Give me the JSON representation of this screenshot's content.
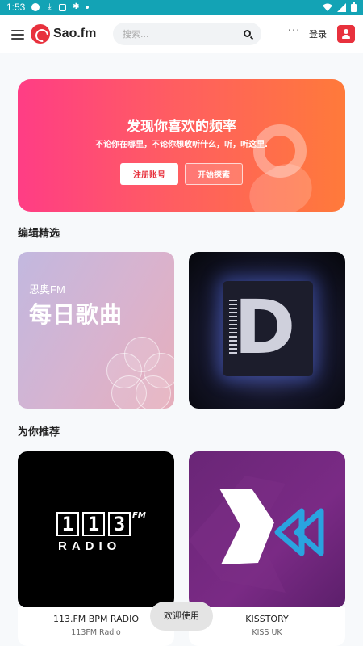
{
  "status_bar": {
    "time": "1:53",
    "icons_left": [
      "record-icon",
      "download-icon",
      "notification-icon",
      "bug-icon",
      "dot-icon"
    ],
    "icons_right": [
      "wifi-icon",
      "signal-icon",
      "battery-icon"
    ],
    "color": "#13a3b5"
  },
  "header": {
    "brand": "Sao.fm",
    "search_placeholder": "搜索...",
    "more_label": "···",
    "login_label": "登录",
    "accent": "#e8313d"
  },
  "banner": {
    "title": "发现你喜欢的频率",
    "subtitle": "不论你在哪里，不论你想收听什么，听，听这里.",
    "register_label": "注册账号",
    "explore_label": "开始探索"
  },
  "editors_picks": {
    "title": "编辑精选",
    "cards": [
      {
        "kicker": "思奥FM",
        "headline": "每日歌曲"
      },
      {
        "image": "dj-logo-artwork"
      }
    ]
  },
  "recommended": {
    "title": "为你推荐",
    "stations": [
      {
        "name": "113.FM BPM RADIO",
        "sub": "113FM Radio",
        "logo_digits": [
          "1",
          "1",
          "3"
        ],
        "logo_fm": "FM",
        "logo_word": "RADIO"
      },
      {
        "name": "KISSTORY",
        "sub": "KISS UK"
      }
    ]
  },
  "toast": {
    "text": "欢迎使用"
  }
}
